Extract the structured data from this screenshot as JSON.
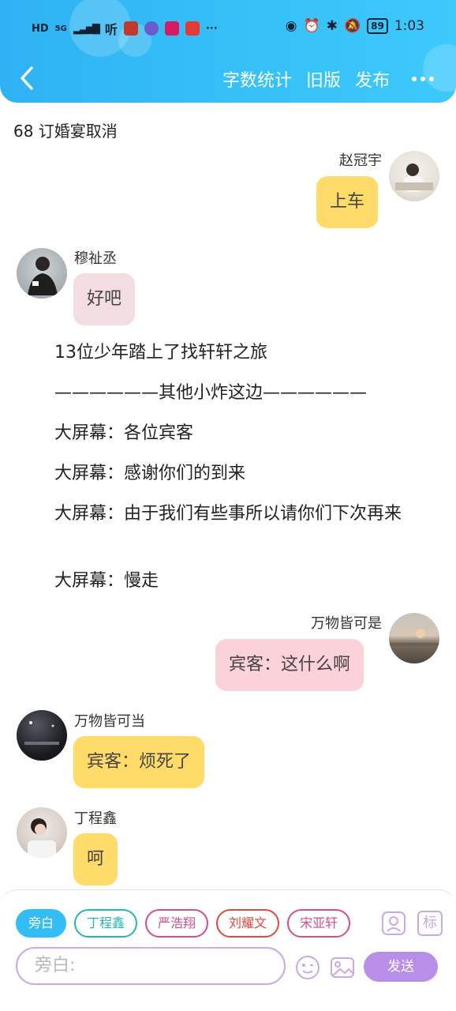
{
  "status_bar": {
    "left_text": "HD",
    "signal": "5G",
    "app_letters": "听",
    "battery": "89",
    "time": "1:03",
    "colors": {
      "app1": "#c0392b",
      "app2": "#6a5acd",
      "app3": "#d81b60",
      "app4": "#e53935"
    }
  },
  "navbar": {
    "back_icon": "chevron-left-icon",
    "word_count": "字数统计",
    "old_version": "旧版",
    "publish": "发布",
    "more_icon": "more-dots-icon"
  },
  "chapter": {
    "title": "68 订婚宴取消"
  },
  "messages": [
    {
      "side": "right",
      "sender": "赵冠宇",
      "text": "上车",
      "color": "#ffdb6a"
    },
    {
      "side": "left",
      "sender": "穆祉丞",
      "text": "好吧",
      "color": "#f2dde0"
    },
    {
      "side": "right",
      "sender": "万物皆可是",
      "text": "宾客：这什么啊",
      "color": "#fbd2da"
    },
    {
      "side": "left",
      "sender": "万物皆可当",
      "text": "宾客：烦死了",
      "color": "#ffdb6a"
    },
    {
      "side": "left",
      "sender": "丁程鑫",
      "text": "呵",
      "color": "#ffdb6a"
    }
  ],
  "narration": [
    "13位少年踏上了找轩轩之旅",
    "——————其他小炸这边——————",
    "大屏幕：各位宾客",
    "大屏幕：感谢你们的到来",
    "大屏幕：由于我们有些事所以请你们下次再来",
    "大屏幕：慢走"
  ],
  "composer": {
    "roles": [
      {
        "label": "旁白",
        "color": "#33bdf5",
        "active": true
      },
      {
        "label": "丁程鑫",
        "color": "#26b5b5",
        "active": false
      },
      {
        "label": "严浩翔",
        "color": "#d64d8c",
        "active": false
      },
      {
        "label": "刘耀文",
        "color": "#e0493f",
        "active": false
      },
      {
        "label": "宋亚轩",
        "color": "#d64d8c",
        "active": false
      }
    ],
    "role_icon": "person-card-icon",
    "tag_label": "标",
    "input_placeholder": "旁白:",
    "emoji_icon": "emoji-icon",
    "image_icon": "image-icon",
    "send_label": "发送",
    "accent": "#b98ee9"
  }
}
